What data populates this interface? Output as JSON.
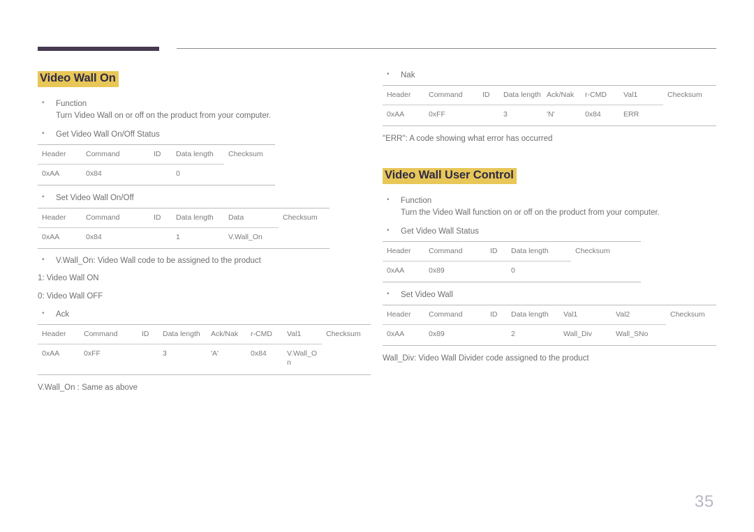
{
  "page": {
    "number": "35"
  },
  "left": {
    "heading": "Video Wall On",
    "function_label": "Function",
    "function_text": "Turn Video Wall on or off on the product from your computer.",
    "get_status_label": "Get Video Wall On/Off Status",
    "table_get": {
      "headers": [
        "Header",
        "Command",
        "ID",
        "Data length",
        "Checksum"
      ],
      "rows": [
        [
          "0xAA",
          "0x84",
          "",
          "0",
          ""
        ]
      ]
    },
    "set_label": "Set Video Wall On/Off",
    "table_set": {
      "headers": [
        "Header",
        "Command",
        "ID",
        "Data length",
        "Data",
        "Checksum"
      ],
      "rows": [
        [
          "0xAA",
          "0x84",
          "",
          "1",
          "V.Wall_On",
          ""
        ]
      ]
    },
    "note_bullet": "V.Wall_On: Video Wall code to be assigned to the product",
    "note_on": "1: Video Wall ON",
    "note_off": "0: Video Wall OFF",
    "ack_label": "Ack",
    "table_ack": {
      "headers": [
        "Header",
        "Command",
        "ID",
        "Data length",
        "Ack/Nak",
        "r-CMD",
        "Val1",
        "Checksum"
      ],
      "rows": [
        [
          "0xAA",
          "0xFF",
          "",
          "3",
          "'A'",
          "0x84",
          "V.Wall_On",
          ""
        ]
      ]
    },
    "ack_note": "V.Wall_On : Same as above"
  },
  "right": {
    "nak_label": "Nak",
    "table_nak": {
      "headers": [
        "Header",
        "Command",
        "ID",
        "Data length",
        "Ack/Nak",
        "r-CMD",
        "Val1",
        "Checksum"
      ],
      "rows": [
        [
          "0xAA",
          "0xFF",
          "",
          "3",
          "'N'",
          "0x84",
          "ERR",
          ""
        ]
      ]
    },
    "err_note": "\"ERR\": A code showing what error has occurred",
    "heading": "Video Wall User Control",
    "function_label": "Function",
    "function_text": "Turn the Video Wall function on or off on the product from your computer.",
    "get_status_label": "Get Video Wall Status",
    "table_get": {
      "headers": [
        "Header",
        "Command",
        "ID",
        "Data length",
        "Checksum"
      ],
      "rows": [
        [
          "0xAA",
          "0x89",
          "",
          "0",
          ""
        ]
      ]
    },
    "set_label": "Set Video Wall",
    "table_set": {
      "headers": [
        "Header",
        "Command",
        "ID",
        "Data length",
        "Val1",
        "Val2",
        "Checksum"
      ],
      "rows": [
        [
          "0xAA",
          "0x89",
          "",
          "2",
          "Wall_Div",
          "Wall_SNo",
          ""
        ]
      ]
    },
    "wall_div_note": "Wall_Div: Video Wall Divider code assigned to the product"
  },
  "colors": {
    "highlight": "#e8c758",
    "heading_text": "#2f2a46",
    "body_text": "#6d6e71",
    "rule_dark": "#453a52",
    "rule_light": "#b9babd"
  }
}
